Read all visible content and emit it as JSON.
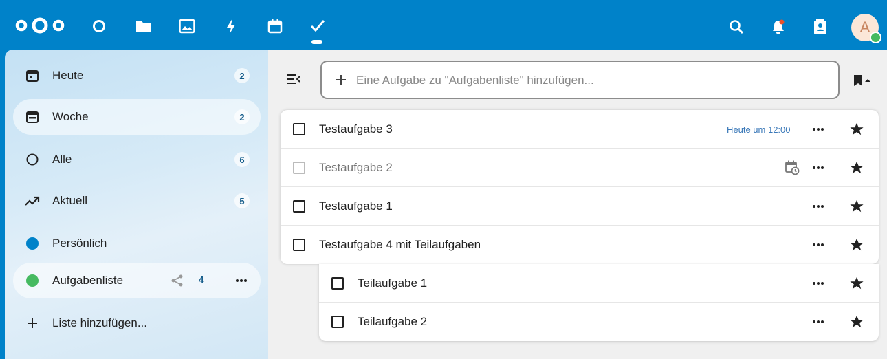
{
  "header": {
    "apps": [
      {
        "name": "dashboard-icon"
      },
      {
        "name": "files-icon"
      },
      {
        "name": "photos-icon"
      },
      {
        "name": "activity-icon"
      },
      {
        "name": "calendar-icon"
      },
      {
        "name": "tasks-icon",
        "active": true
      }
    ],
    "right_icons": [
      "search-icon",
      "notifications-icon",
      "contacts-icon"
    ],
    "avatar_letter": "A",
    "avatar_status_color": "#46ba61",
    "brand_color": "#0082c9"
  },
  "sidebar": {
    "items": [
      {
        "label": "Heute",
        "count": "2",
        "icon": "calendar-today-icon"
      },
      {
        "label": "Woche",
        "count": "2",
        "icon": "calendar-week-icon"
      },
      {
        "label": "Alle",
        "count": "6",
        "icon": "circle-outline-icon"
      },
      {
        "label": "Aktuell",
        "count": "5",
        "icon": "trending-up-icon"
      },
      {
        "label": "Persönlich",
        "color": "#0082c9"
      },
      {
        "label": "Aufgabenliste",
        "count": "4",
        "color": "#46ba61",
        "shared": true
      }
    ],
    "add_list_label": "Liste hinzufügen..."
  },
  "main": {
    "add_task_placeholder": "Eine Aufgabe zu \"Aufgabenliste\" hinzufügen...",
    "tasks": [
      {
        "title": "Testaufgabe 3",
        "due": "Heute um 12:00",
        "starred": true
      },
      {
        "title": "Testaufgabe 2",
        "muted": true,
        "scheduled": true,
        "starred": true
      },
      {
        "title": "Testaufgabe 1",
        "starred": true
      },
      {
        "title": "Testaufgabe 4 mit Teilaufgaben",
        "starred": true
      }
    ],
    "subtasks": [
      {
        "title": "Teilaufgabe 1",
        "starred": true
      },
      {
        "title": "Teilaufgabe 2",
        "starred": true
      }
    ]
  }
}
